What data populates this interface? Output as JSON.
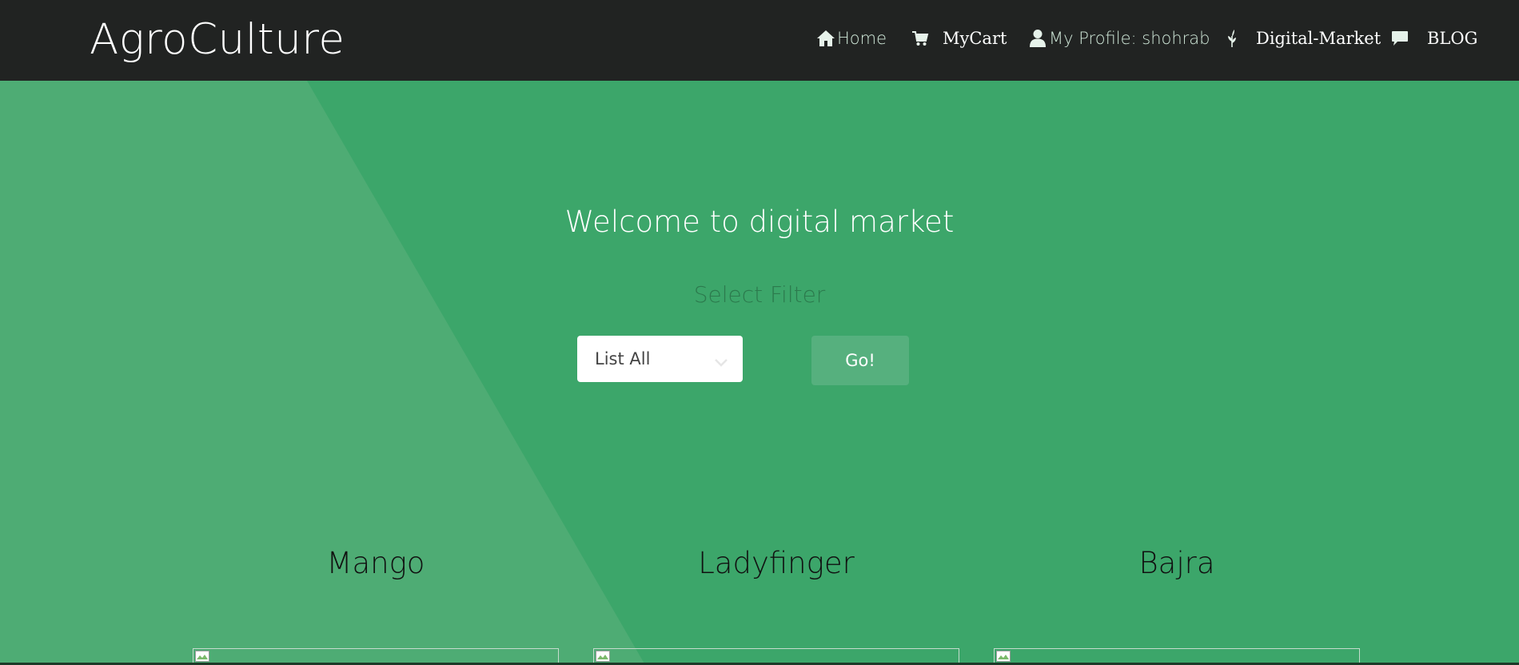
{
  "brand": "AgroCulture",
  "nav": {
    "home": "Home",
    "cart": "MyCart",
    "profile": "My Profile: shohrab",
    "market": "Digital-Market",
    "blog": "BLOG"
  },
  "hero": {
    "welcome": "Welcome to digital market",
    "select_filter": "Select Filter",
    "filter_value": "List All",
    "go_label": "Go!"
  },
  "products": [
    {
      "name": "Mango"
    },
    {
      "name": "Ladyfinger"
    },
    {
      "name": "Bajra"
    }
  ],
  "colors": {
    "header_bg": "#212322",
    "hero_bg": "#3ca66a",
    "hero_diagonal": "#4eac74",
    "go_button": "#56b07e"
  },
  "icons": {
    "home": "home-icon",
    "cart": "cart-icon",
    "profile": "user-icon",
    "market": "leaf-icon",
    "blog": "comment-icon",
    "select": "chevron-down-icon"
  }
}
